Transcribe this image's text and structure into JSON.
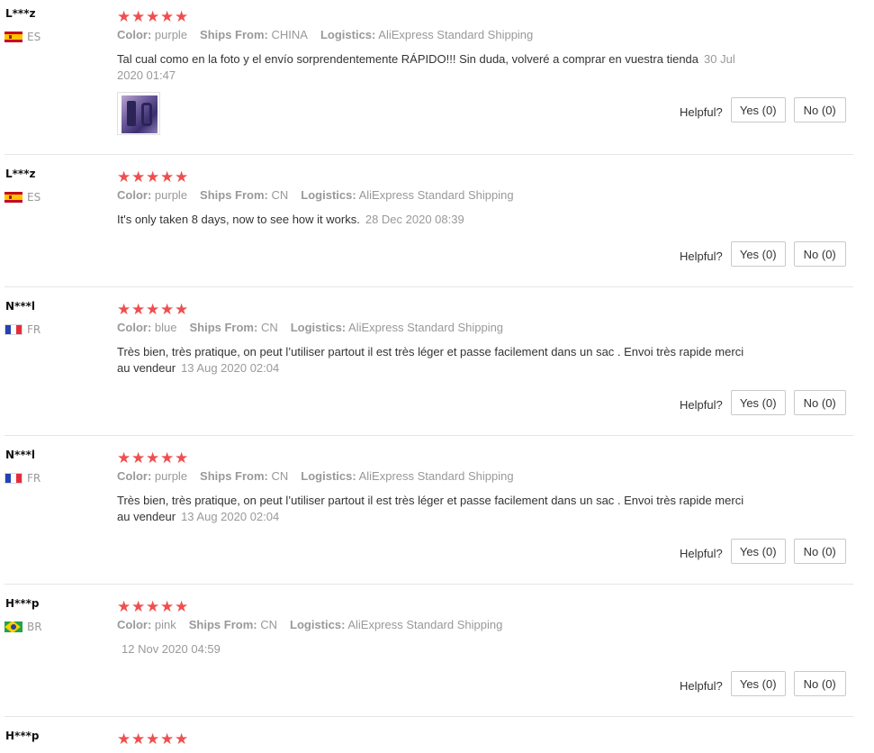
{
  "labels": {
    "color": "Color:",
    "ships_from": "Ships From:",
    "logistics": "Logistics:",
    "helpful": "Helpful?",
    "star_glyph": "★"
  },
  "star_color": "#ef4f4f",
  "reviews": [
    {
      "user": "L***z",
      "country": "ES",
      "flag_icon": "spain-flag-icon",
      "rating": 5,
      "color": "purple",
      "ships_from": "CHINA",
      "logistics": "AliExpress Standard Shipping",
      "text": "Tal cual como en la foto y el envío sorprendentemente RÁPIDO!!! Sin duda, volveré a comprar en vuestra tienda",
      "date": "30 Jul 2020 01:47",
      "has_photo": true,
      "yes_label": "Yes (0)",
      "no_label": "No (0)"
    },
    {
      "user": "L***z",
      "country": "ES",
      "flag_icon": "spain-flag-icon",
      "rating": 5,
      "color": "purple",
      "ships_from": "CN",
      "logistics": "AliExpress Standard Shipping",
      "text": "It's only taken 8 days, now to see how it works.",
      "date": "28 Dec 2020 08:39",
      "has_photo": false,
      "yes_label": "Yes (0)",
      "no_label": "No (0)"
    },
    {
      "user": "N***l",
      "country": "FR",
      "flag_icon": "france-flag-icon",
      "rating": 5,
      "color": "blue",
      "ships_from": "CN",
      "logistics": "AliExpress Standard Shipping",
      "text": "Très bien, très pratique, on peut l’utiliser partout il est très léger et passe facilement dans un sac . Envoi très rapide merci au vendeur",
      "date": "13 Aug 2020 02:04",
      "has_photo": false,
      "yes_label": "Yes (0)",
      "no_label": "No (0)"
    },
    {
      "user": "N***l",
      "country": "FR",
      "flag_icon": "france-flag-icon",
      "rating": 5,
      "color": "purple",
      "ships_from": "CN",
      "logistics": "AliExpress Standard Shipping",
      "text": "Très bien, très pratique, on peut l’utiliser partout il est très léger et passe facilement dans un sac . Envoi très rapide merci au vendeur",
      "date": "13 Aug 2020 02:04",
      "has_photo": false,
      "yes_label": "Yes (0)",
      "no_label": "No (0)"
    },
    {
      "user": "H***p",
      "country": "BR",
      "flag_icon": "brazil-flag-icon",
      "rating": 5,
      "color": "pink",
      "ships_from": "CN",
      "logistics": "AliExpress Standard Shipping",
      "text": "",
      "date": "12 Nov 2020 04:59",
      "has_photo": false,
      "yes_label": "Yes (0)",
      "no_label": "No (0)"
    },
    {
      "user": "H***p",
      "country": "",
      "flag_icon": "",
      "rating": 5,
      "color": "",
      "ships_from": "",
      "logistics": "",
      "text": "",
      "date": "",
      "has_photo": false,
      "yes_label": "",
      "no_label": "",
      "partial": true
    }
  ]
}
